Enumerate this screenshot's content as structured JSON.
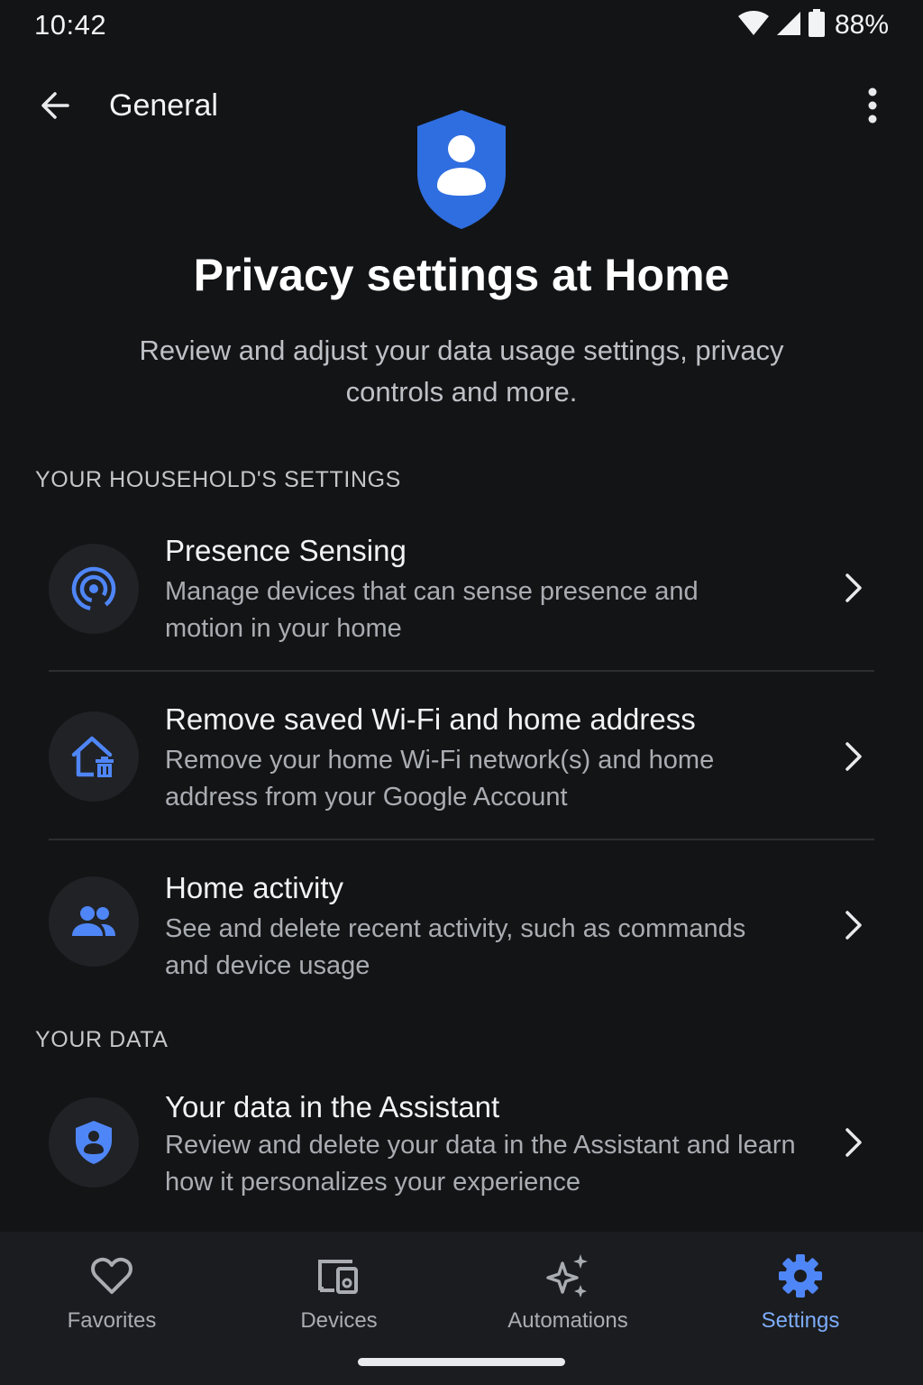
{
  "status_bar": {
    "time": "10:42",
    "battery": "88%"
  },
  "header": {
    "title": "General",
    "back_icon": "arrow-back-icon",
    "more_icon": "more-vert-icon"
  },
  "hero": {
    "title": "Privacy settings at Home",
    "subtitle": "Review and adjust your data usage settings, privacy controls and more.",
    "icon": "shield-person-icon"
  },
  "sections": [
    {
      "header": "YOUR HOUSEHOLD'S SETTINGS",
      "items": [
        {
          "title": "Presence Sensing",
          "description": "Manage devices that can sense presence and motion in your home",
          "icon": "presence-sensing-icon"
        },
        {
          "title": "Remove saved Wi-Fi and home address",
          "description": "Remove your home Wi-Fi network(s) and home address from your Google Account",
          "icon": "home-delete-icon"
        },
        {
          "title": "Home activity",
          "description": "See and delete recent activity, such as commands and device usage",
          "icon": "people-icon"
        }
      ]
    },
    {
      "header": "YOUR DATA",
      "items": [
        {
          "title": "Your data in the Assistant",
          "description": "Review and delete your data in the Assistant and learn how it personalizes your experience",
          "icon": "shield-person-icon"
        }
      ]
    }
  ],
  "bottom_nav": {
    "items": [
      {
        "label": "Favorites",
        "icon": "heart-icon",
        "active": false
      },
      {
        "label": "Devices",
        "icon": "devices-icon",
        "active": false
      },
      {
        "label": "Automations",
        "icon": "sparkle-icon",
        "active": false
      },
      {
        "label": "Settings",
        "icon": "gear-icon",
        "active": true
      }
    ]
  },
  "colors": {
    "background": "#131416",
    "accent": "#7cacf8",
    "icon_blue": "#4f86f7",
    "hero_blue": "#2f6ee0",
    "text_primary": "#f1f3f4",
    "text_secondary": "#a9adb2"
  }
}
